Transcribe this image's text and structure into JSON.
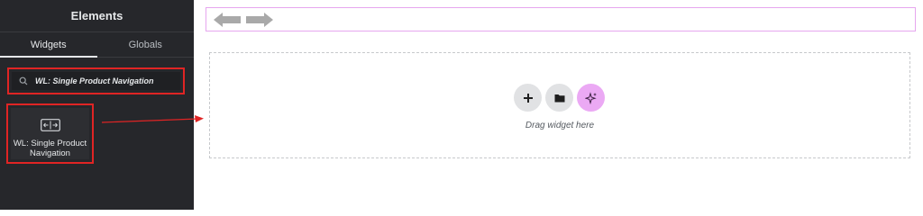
{
  "sidebar": {
    "title": "Elements",
    "tabs": [
      {
        "label": "Widgets",
        "active": true
      },
      {
        "label": "Globals",
        "active": false
      }
    ],
    "search": {
      "value": "WL: Single Product Navigation",
      "icon": "search-icon"
    },
    "widget": {
      "label": "WL: Single Product Navigation",
      "icon": "product-navigation-icon"
    },
    "highlight_color": "#e02424"
  },
  "canvas": {
    "nav_arrows": [
      "arrow-left-icon",
      "arrow-right-icon"
    ],
    "buttons": [
      {
        "icon": "plus-icon"
      },
      {
        "icon": "folder-icon"
      },
      {
        "icon": "ai-sparkle-icon"
      }
    ],
    "drop_text": "Drag widget here",
    "accent_color": "#eba9f4"
  }
}
